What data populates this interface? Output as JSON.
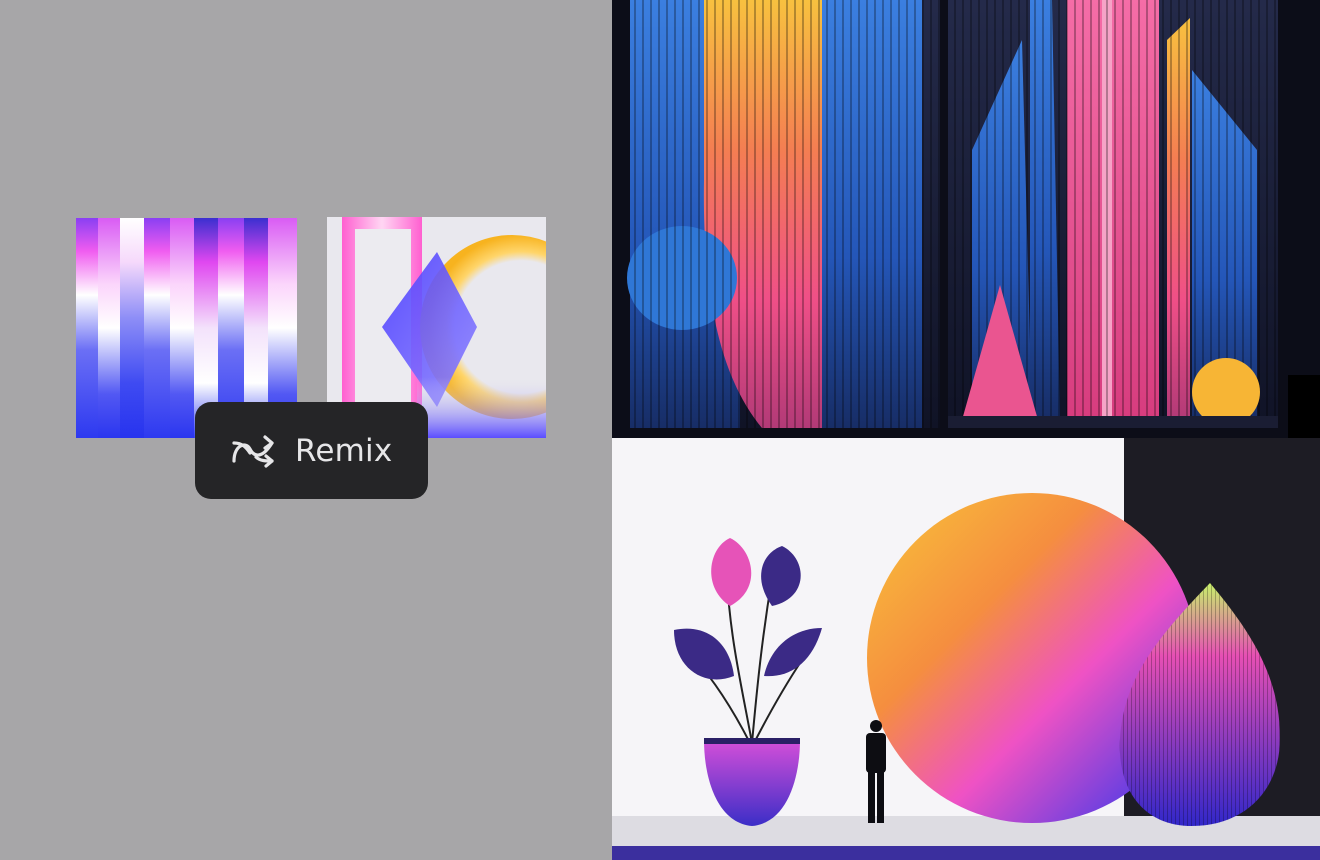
{
  "remix_button": {
    "label": "Remix",
    "icon": "shuffle-icon"
  },
  "input_images": [
    {
      "name": "gradient-stripes",
      "palette": [
        "#ff49e6",
        "#ffffff",
        "#3a45f5"
      ]
    },
    {
      "name": "shapes-abstract",
      "palette": [
        "#ff4fc8",
        "#6a5cff",
        "#ffbf2f"
      ]
    }
  ],
  "output_images": [
    {
      "name": "stripes-architecture",
      "palette": [
        "#1c2545",
        "#f29a3d",
        "#f14f97",
        "#3b7fe0"
      ]
    },
    {
      "name": "plant-person-sphere",
      "palette": [
        "#f7f6f8",
        "#f9b83c",
        "#e84fc8",
        "#4a36d8"
      ]
    }
  ],
  "colors": {
    "background": "#a7a6a8",
    "button_bg": "#252527",
    "button_text": "#e6e6e8"
  }
}
